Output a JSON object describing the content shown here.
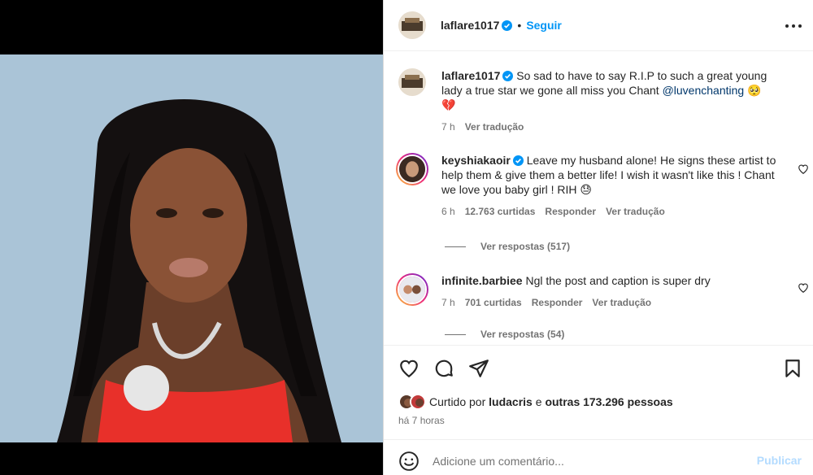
{
  "post": {
    "username": "laflare1017",
    "separator": "•",
    "follow_label": "Seguir"
  },
  "caption": {
    "username": "laflare1017",
    "text": " So sad to have to say R.I.P to such a great young lady a true star we gone all miss you Chant ",
    "mention": "@luvenchanting",
    "emoji": "🥺",
    "emoji2": "💔",
    "time": "7 h",
    "translate": "Ver tradução"
  },
  "comments": [
    {
      "username": "keyshiakaoir",
      "text": " Leave my husband alone! He signs these artist to help them & give them a better life! I wish it wasn't like this ! Chant we love you baby girl ! RIH 😓",
      "time": "6 h",
      "likes": "12.763 curtidas",
      "reply": "Responder",
      "translate": "Ver tradução",
      "replies": "Ver respostas (517)"
    },
    {
      "username": "infinite.barbiee",
      "text": " Ngl the post and caption is super dry",
      "time": "7 h",
      "likes": "701 curtidas",
      "reply": "Responder",
      "translate": "Ver tradução",
      "replies": "Ver respostas (54)"
    }
  ],
  "likes": {
    "prefix": "Curtido por ",
    "user": "ludacris",
    "middle": " e ",
    "others": "outras 173.296 pessoas"
  },
  "time_ago": "há 7 horas",
  "comment_box": {
    "placeholder": "Adicione um comentário...",
    "publish": "Publicar"
  },
  "colors": {
    "accent": "#0095f6",
    "verified": "#0095f6",
    "muted": "#737373",
    "publish_disabled": "#b3dbff"
  },
  "icons": {
    "like": "heart-icon",
    "comment": "speech-bubble-icon",
    "share": "paper-plane-icon",
    "save": "bookmark-icon",
    "more": "ellipsis-icon",
    "emoji": "smiley-icon"
  }
}
